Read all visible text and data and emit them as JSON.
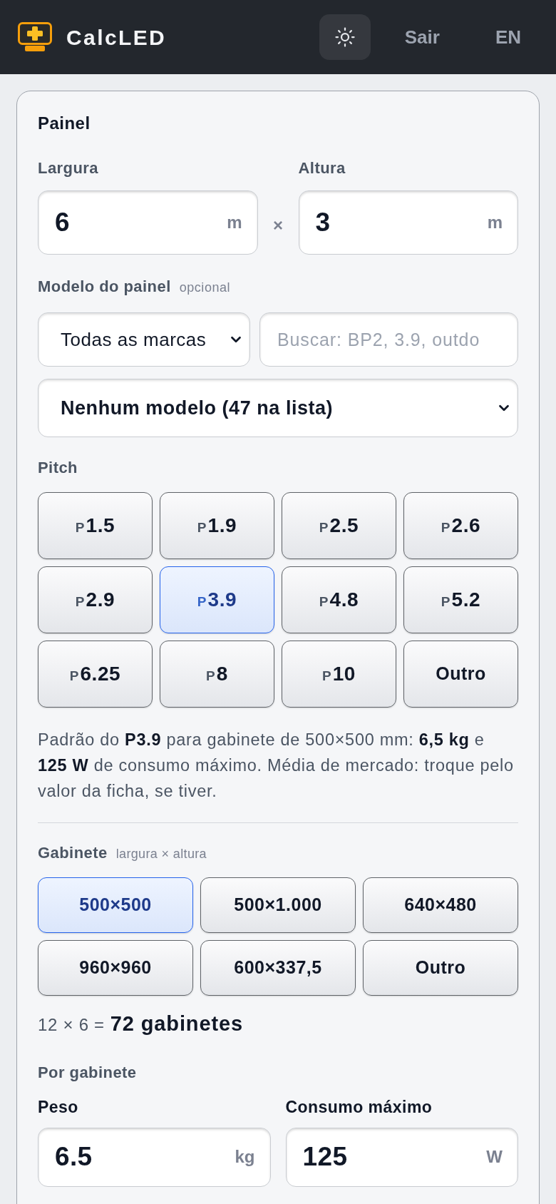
{
  "header": {
    "app_name": "CalcLED",
    "logout": "Sair",
    "language": "EN"
  },
  "panel": {
    "title": "Painel",
    "width": {
      "label": "Largura",
      "value": "6",
      "unit": "m"
    },
    "separator": "×",
    "height": {
      "label": "Altura",
      "value": "3",
      "unit": "m"
    }
  },
  "model": {
    "label": "Modelo do painel",
    "hint": "opcional",
    "brand_select": {
      "value": "Todas as marcas"
    },
    "search": {
      "placeholder": "Buscar: BP2, 3.9, outdo"
    },
    "model_select": {
      "value": "Nenhum modelo (47 na lista)"
    }
  },
  "pitch": {
    "label": "Pitch",
    "options": [
      {
        "kind": "pitch",
        "prefix": "P",
        "value": "1.5",
        "selected": false
      },
      {
        "kind": "pitch",
        "prefix": "P",
        "value": "1.9",
        "selected": false
      },
      {
        "kind": "pitch",
        "prefix": "P",
        "value": "2.5",
        "selected": false
      },
      {
        "kind": "pitch",
        "prefix": "P",
        "value": "2.6",
        "selected": false
      },
      {
        "kind": "pitch",
        "prefix": "P",
        "value": "2.9",
        "selected": false
      },
      {
        "kind": "pitch",
        "prefix": "P",
        "value": "3.9",
        "selected": true
      },
      {
        "kind": "pitch",
        "prefix": "P",
        "value": "4.8",
        "selected": false
      },
      {
        "kind": "pitch",
        "prefix": "P",
        "value": "5.2",
        "selected": false
      },
      {
        "kind": "pitch",
        "prefix": "P",
        "value": "6.25",
        "selected": false
      },
      {
        "kind": "pitch",
        "prefix": "P",
        "value": "8",
        "selected": false
      },
      {
        "kind": "pitch",
        "prefix": "P",
        "value": "10",
        "selected": false
      },
      {
        "kind": "other",
        "value": "Outro",
        "selected": false
      }
    ],
    "note": "Padrão do **P3.9** para gabinete de 500×500 mm: **6,5 kg** e **125 W** de consumo máximo. Média de mercado: troque pelo valor da ficha, se tiver."
  },
  "cabinet": {
    "label": "Gabinete",
    "hint": "largura × altura",
    "options": [
      {
        "label": "500×500",
        "selected": true
      },
      {
        "label": "500×1.000",
        "selected": false
      },
      {
        "label": "640×480",
        "selected": false
      },
      {
        "label": "960×960",
        "selected": false
      },
      {
        "label": "600×337,5",
        "selected": false
      },
      {
        "label": "Outro",
        "selected": false
      }
    ],
    "count": {
      "formula": "12 × 6 =",
      "result": "72 gabinetes"
    }
  },
  "per_cabinet": {
    "label": "Por gabinete",
    "weight": {
      "label": "Peso",
      "value": "6.5",
      "unit": "kg"
    },
    "power": {
      "label": "Consumo máximo",
      "value": "125",
      "unit": "W"
    }
  }
}
